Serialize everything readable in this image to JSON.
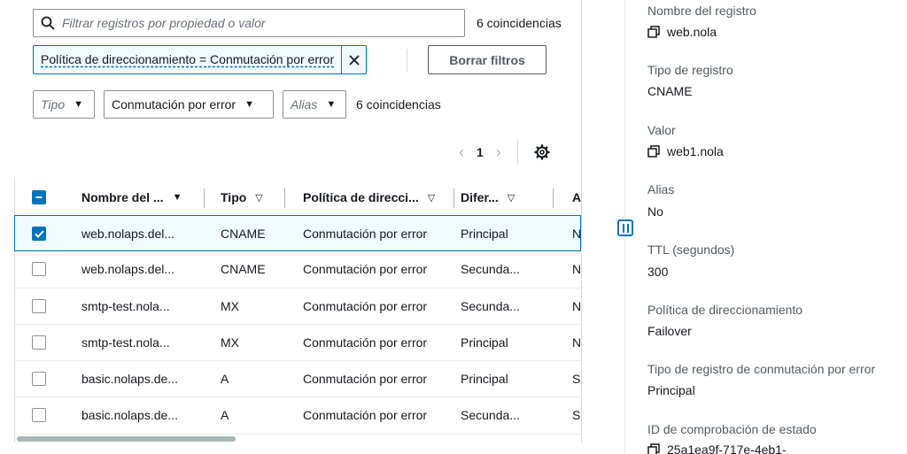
{
  "filter": {
    "search_placeholder": "Filtrar registros por propiedad o valor",
    "matches_top": "6 coincidencias",
    "token_label": "Política de direccionamiento = Conmutación por error",
    "clear_button": "Borrar filtros",
    "type_select_placeholder": "Tipo",
    "routing_select_value": "Conmutación por error",
    "alias_select_placeholder": "Alias",
    "matches_mid": "6 coincidencias"
  },
  "pagination": {
    "current_page": "1"
  },
  "table": {
    "columns": [
      "Nombre del ...",
      "Tipo",
      "Política de direcci...",
      "Difer...",
      "A"
    ],
    "rows": [
      {
        "name": "web.nolaps.del...",
        "type": "CNAME",
        "policy": "Conmutación por error",
        "diff": "Principal",
        "alias": "N",
        "selected": true
      },
      {
        "name": "web.nolaps.del...",
        "type": "CNAME",
        "policy": "Conmutación por error",
        "diff": "Secunda...",
        "alias": "N",
        "selected": false
      },
      {
        "name": "smtp-test.nola...",
        "type": "MX",
        "policy": "Conmutación por error",
        "diff": "Secunda...",
        "alias": "N",
        "selected": false
      },
      {
        "name": "smtp-test.nola...",
        "type": "MX",
        "policy": "Conmutación por error",
        "diff": "Principal",
        "alias": "N",
        "selected": false
      },
      {
        "name": "basic.nolaps.de...",
        "type": "A",
        "policy": "Conmutación por error",
        "diff": "Principal",
        "alias": "Sí",
        "selected": false
      },
      {
        "name": "basic.nolaps.de...",
        "type": "A",
        "policy": "Conmutación por error",
        "diff": "Secunda...",
        "alias": "Sí",
        "selected": false
      }
    ]
  },
  "details": {
    "record_name_label": "Nombre del registro",
    "record_name_value": "web.nola",
    "record_type_label": "Tipo de registro",
    "record_type_value": "CNAME",
    "value_label": "Valor",
    "value_value": "web1.nola",
    "alias_label": "Alias",
    "alias_value": "No",
    "ttl_label": "TTL (segundos)",
    "ttl_value": "300",
    "routing_label": "Política de direccionamiento",
    "routing_value": "Failover",
    "failover_type_label": "Tipo de registro de conmutación por error",
    "failover_type_value": "Principal",
    "health_check_label": "ID de comprobación de estado",
    "health_check_value": "25a1ea9f-717e-4eb1-"
  },
  "colors": {
    "accent": "#0073bb",
    "text": "#16191f",
    "muted": "#545b64"
  }
}
